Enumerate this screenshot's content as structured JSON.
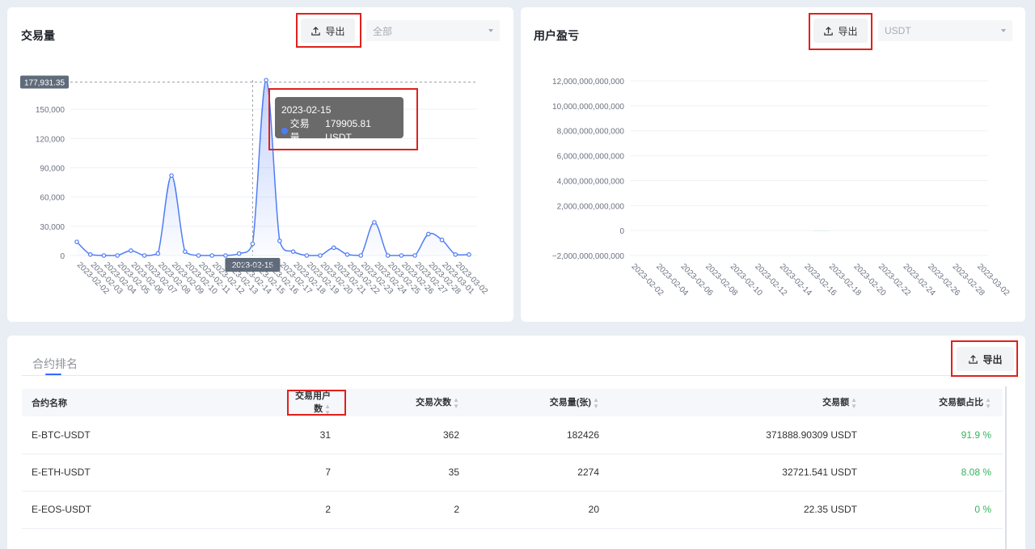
{
  "volume_card": {
    "title": "交易量",
    "export_label": "导出",
    "filter_value": "全部",
    "tooltip": {
      "date": "2023-02-15",
      "series": "交易量",
      "value": "179905.81 USDT"
    },
    "axis_pointer_label": "2023-02-15",
    "max_marker": "177,931.35"
  },
  "pnl_card": {
    "title": "用户盈亏",
    "export_label": "导出",
    "filter_value": "USDT"
  },
  "ranking": {
    "tab_label": "合约排名",
    "export_label": "导出",
    "columns": [
      "合约名称",
      "交易用户数",
      "交易次数",
      "交易量(张)",
      "交易额",
      "交易额占比"
    ],
    "rows": [
      {
        "name": "E-BTC-USDT",
        "users": "31",
        "trades": "362",
        "volume": "182426",
        "amount": "371888.90309 USDT",
        "ratio": "91.9 %"
      },
      {
        "name": "E-ETH-USDT",
        "users": "7",
        "trades": "35",
        "volume": "2274",
        "amount": "32721.541 USDT",
        "ratio": "8.08 %"
      },
      {
        "name": "E-EOS-USDT",
        "users": "2",
        "trades": "2",
        "volume": "20",
        "amount": "22.35 USDT",
        "ratio": "0 %"
      }
    ]
  },
  "colors": {
    "line": "#4f7df5",
    "bar": "#4fd9b7",
    "highlight": "#e0201c",
    "positive": "#35b45a"
  },
  "chart_data": [
    {
      "type": "line",
      "smooth": true,
      "area_fill": true,
      "x": [
        "2023-02-02",
        "2023-02-03",
        "2023-02-04",
        "2023-02-05",
        "2023-02-06",
        "2023-02-07",
        "2023-02-08",
        "2023-02-09",
        "2023-02-10",
        "2023-02-11",
        "2023-02-12",
        "2023-02-13",
        "2023-02-14",
        "2023-02-15",
        "2023-02-16",
        "2023-02-17",
        "2023-02-18",
        "2023-02-19",
        "2023-02-20",
        "2023-02-21",
        "2023-02-22",
        "2023-02-23",
        "2023-02-24",
        "2023-02-25",
        "2023-02-26",
        "2023-02-27",
        "2023-02-28",
        "2023-03-01",
        "2023-03-02"
      ],
      "series": [
        {
          "values": [
            14000,
            1000,
            0,
            0,
            5000,
            0,
            2000,
            82000,
            4000,
            0,
            0,
            0,
            2000,
            12000,
            179906,
            15000,
            4000,
            0,
            0,
            8000,
            1000,
            0,
            34000,
            0,
            0,
            0,
            22000,
            16000,
            1000,
            1000
          ]
        }
      ],
      "yticks": [
        "0",
        "30,000",
        "60,000",
        "90,000",
        "120,000",
        "150,000"
      ],
      "ylim": [
        0,
        180000
      ],
      "max_line": 177931.35,
      "grid": true
    },
    {
      "type": "bar",
      "x": [
        "2023-02-02",
        "2023-02-03",
        "2023-02-04",
        "2023-02-05",
        "2023-02-06",
        "2023-02-07",
        "2023-02-08",
        "2023-02-09",
        "2023-02-10",
        "2023-02-11",
        "2023-02-12",
        "2023-02-13",
        "2023-02-14",
        "2023-02-15",
        "2023-02-16",
        "2023-02-17",
        "2023-02-18",
        "2023-02-19",
        "2023-02-20",
        "2023-02-21",
        "2023-02-22",
        "2023-02-23",
        "2023-02-24",
        "2023-02-25",
        "2023-02-26",
        "2023-02-27",
        "2023-02-28",
        "2023-03-01",
        "2023-03-02"
      ],
      "xticks": [
        "2023-02-02",
        "2023-02-04",
        "2023-02-06",
        "2023-02-08",
        "2023-02-10",
        "2023-02-12",
        "2023-02-14",
        "2023-02-16",
        "2023-02-18",
        "2023-02-20",
        "2023-02-22",
        "2023-02-24",
        "2023-02-26",
        "2023-02-28",
        "2023-03-02"
      ],
      "series": [
        {
          "values": [
            0,
            0,
            0,
            0,
            0,
            0,
            0,
            0,
            0,
            0,
            0,
            0,
            0,
            0,
            0,
            10000000000,
            0,
            0,
            0,
            0,
            0,
            0,
            0,
            0,
            0,
            0,
            0,
            0,
            0
          ]
        }
      ],
      "bar_range_start": 500000000,
      "yticks": [
        "−2,000,000,000,000",
        "0",
        "2,000,000,000,000",
        "4,000,000,000,000",
        "6,000,000,000,000",
        "8,000,000,000,000",
        "10,000,000,000,000",
        "12,000,000,000,000"
      ],
      "ylim": [
        -2000000000000,
        12000000000000
      ],
      "grid": true
    }
  ]
}
